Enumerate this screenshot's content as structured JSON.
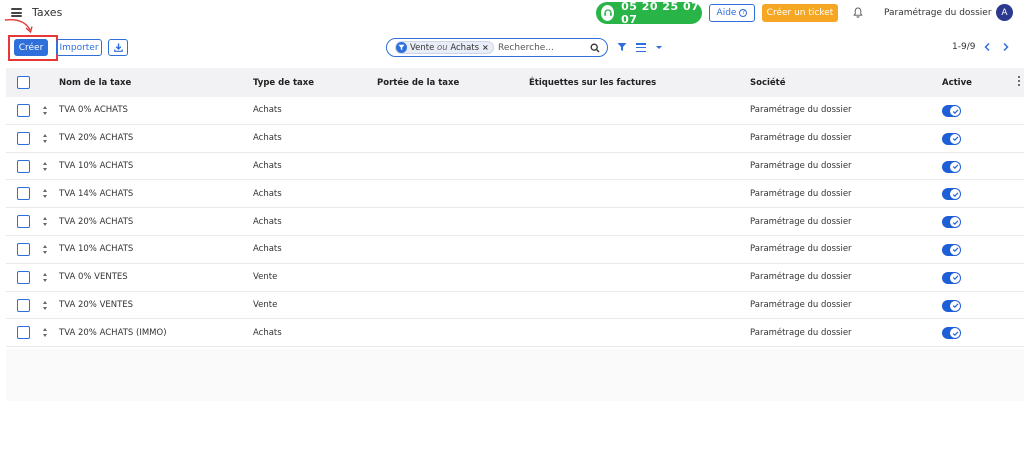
{
  "header": {
    "title": "Taxes",
    "phone": "05 20 25 07 07",
    "help_label": "Aide",
    "ticket_label": "Créer un ticket",
    "company": "Paramétrage du dossier",
    "avatar_initial": "A"
  },
  "toolbar": {
    "create_label": "Créer",
    "import_label": "Importer"
  },
  "search": {
    "facet_value_1": "Vente",
    "facet_separator": "ou",
    "facet_value_2": "Achats",
    "placeholder": "Recherche..."
  },
  "pager": {
    "range": "1-9/9"
  },
  "table": {
    "columns": {
      "name": "Nom de la taxe",
      "type": "Type de taxe",
      "scope": "Portée de la taxe",
      "labels": "Étiquettes sur les factures",
      "company": "Société",
      "active": "Active"
    },
    "rows": [
      {
        "name": "TVA 0% ACHATS",
        "type": "Achats",
        "scope": "",
        "labels": "",
        "company": "Paramétrage du dossier",
        "active": true
      },
      {
        "name": "TVA 20% ACHATS",
        "type": "Achats",
        "scope": "",
        "labels": "",
        "company": "Paramétrage du dossier",
        "active": true
      },
      {
        "name": "TVA 10% ACHATS",
        "type": "Achats",
        "scope": "",
        "labels": "",
        "company": "Paramétrage du dossier",
        "active": true
      },
      {
        "name": "TVA 14% ACHATS",
        "type": "Achats",
        "scope": "",
        "labels": "",
        "company": "Paramétrage du dossier",
        "active": true
      },
      {
        "name": "TVA 20% ACHATS",
        "type": "Achats",
        "scope": "",
        "labels": "",
        "company": "Paramétrage du dossier",
        "active": true
      },
      {
        "name": "TVA 10% ACHATS",
        "type": "Achats",
        "scope": "",
        "labels": "",
        "company": "Paramétrage du dossier",
        "active": true
      },
      {
        "name": "TVA 0% VENTES",
        "type": "Vente",
        "scope": "",
        "labels": "",
        "company": "Paramétrage du dossier",
        "active": true
      },
      {
        "name": "TVA 20% VENTES",
        "type": "Vente",
        "scope": "",
        "labels": "",
        "company": "Paramétrage du dossier",
        "active": true
      },
      {
        "name": "TVA 20% ACHATS (IMMO)",
        "type": "Achats",
        "scope": "",
        "labels": "",
        "company": "Paramétrage du dossier",
        "active": true
      }
    ]
  },
  "icons": {
    "menu": "hamburger-icon",
    "phone": "headset-icon",
    "help": "question-circle-icon",
    "notifications": "bell-icon",
    "download": "download-icon",
    "facet": "funnel-icon",
    "search": "search-icon",
    "filter": "funnel-icon",
    "group_by": "list-icon",
    "options": "caret-down-icon",
    "prev": "chevron-left-icon",
    "next": "chevron-right-icon",
    "row_handle": "sort-handle-icon",
    "active_toggle": "check-icon",
    "column_options": "kebab-icon"
  },
  "colors": {
    "primary": "#2f6fdb",
    "phone_green": "#28b446",
    "ticket_orange": "#f5a623",
    "annotation_red": "#e53935",
    "toggle_on": "#1f5fd6",
    "avatar_bg": "#2b3a8f"
  }
}
